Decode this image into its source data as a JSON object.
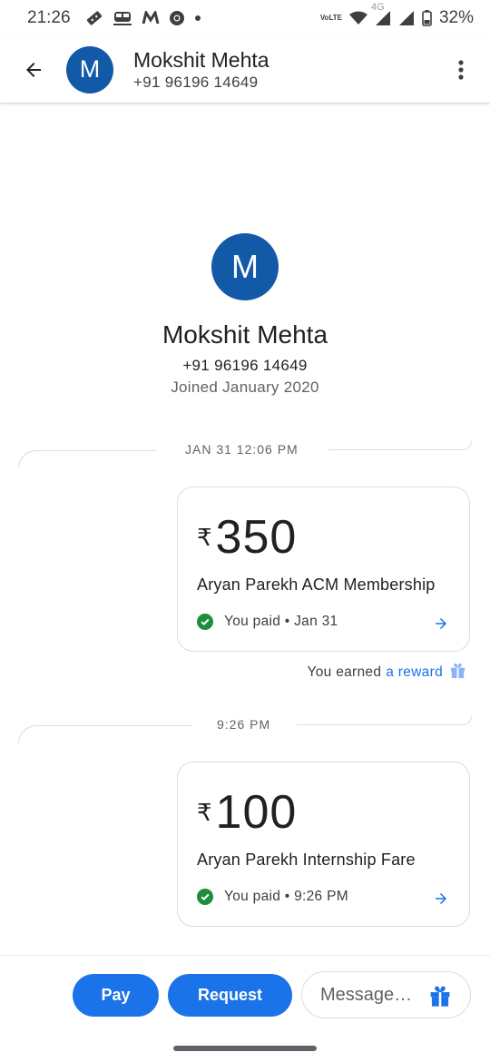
{
  "status_bar": {
    "time": "21:26",
    "notification_icons": [
      "ticket-icon",
      "metro-train-icon",
      "myntra-m-icon",
      "chrome-icon",
      "dot-icon"
    ],
    "volte_top": "Vo",
    "volte_bottom": "LTE",
    "network_label": "4G",
    "battery": "32%"
  },
  "header": {
    "avatar_initial": "M",
    "contact_name": "Mokshit Mehta",
    "contact_phone": "+91 96196 14649"
  },
  "profile": {
    "avatar_initial": "M",
    "name": "Mokshit Mehta",
    "phone": "+91 96196 14649",
    "joined": "Joined January 2020"
  },
  "transactions": [
    {
      "date_label": "JAN 31 12:06 PM",
      "currency_symbol": "₹",
      "amount": "350",
      "note": "Aryan Parekh ACM Membership",
      "status": "You paid • Jan 31"
    },
    {
      "date_label": "9:26 PM",
      "currency_symbol": "₹",
      "amount": "100",
      "note": "Aryan Parekh Internship Fare",
      "status": "You paid • 9:26 PM"
    }
  ],
  "reward": {
    "text": "You earned",
    "link": "a reward"
  },
  "bottom_bar": {
    "pay_label": "Pay",
    "request_label": "Request",
    "message_placeholder": "Message…"
  },
  "colors": {
    "accent": "#1a73e8",
    "avatar": "#1259a8",
    "success": "#1e8e3e"
  }
}
